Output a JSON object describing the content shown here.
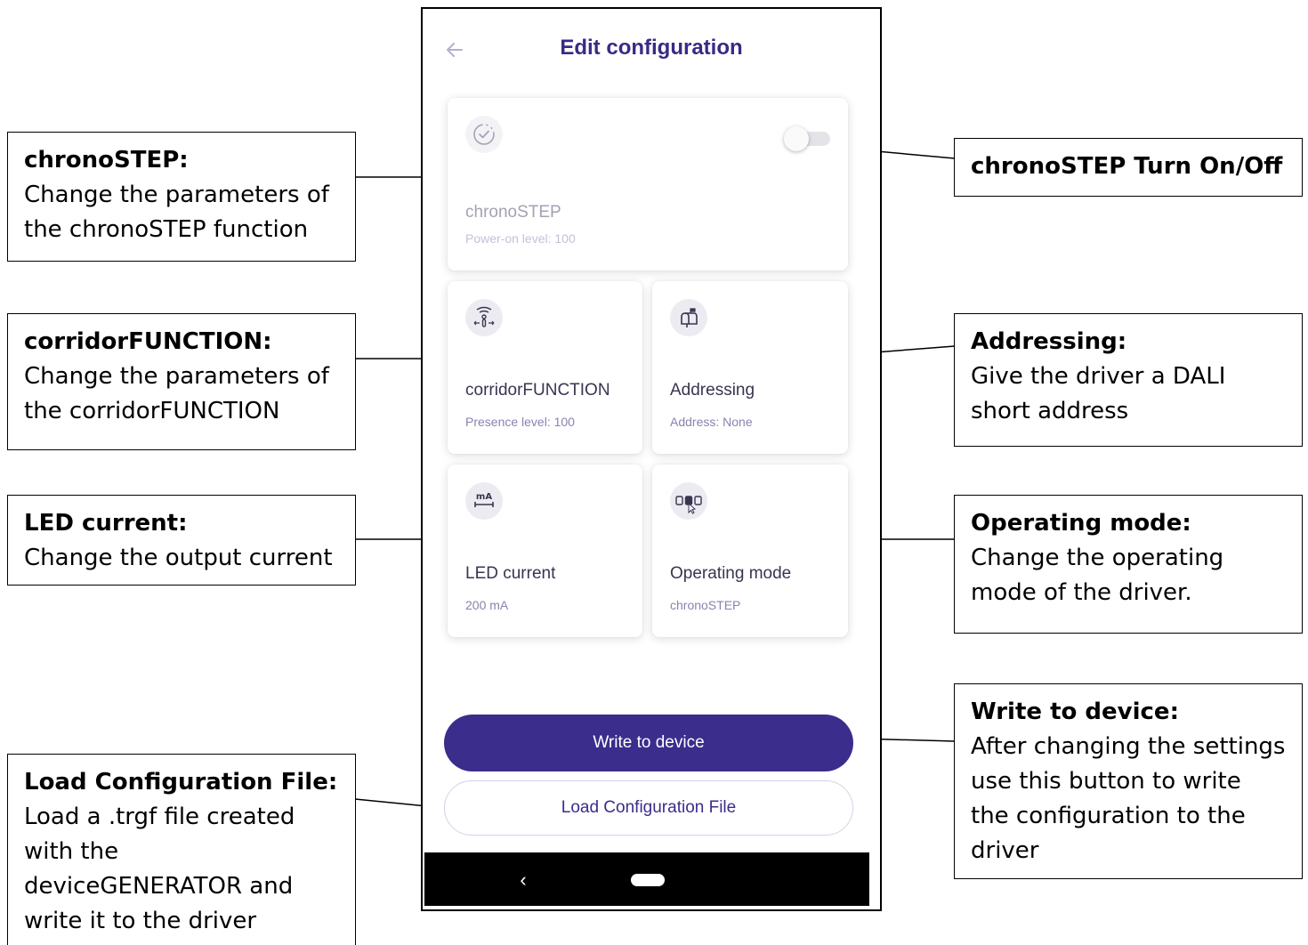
{
  "header": {
    "title": "Edit configuration",
    "back_icon": "arrow-left-icon"
  },
  "cards": {
    "chronostep": {
      "title": "chronoSTEP",
      "subtitle": "Power-on level: 100",
      "icon": "clock-icon",
      "toggle_on": false
    },
    "corridor": {
      "title": "corridorFUNCTION",
      "subtitle": "Presence level: 100",
      "icon": "presence-sensor-icon"
    },
    "addressing": {
      "title": "Addressing",
      "subtitle": "Address: None",
      "icon": "mailbox-icon"
    },
    "led_current": {
      "title": "LED current",
      "subtitle": "200 mA",
      "icon": "milliamp-icon",
      "icon_text": "mA"
    },
    "operating_mode": {
      "title": "Operating mode",
      "subtitle": "chronoSTEP",
      "icon": "mode-select-icon"
    }
  },
  "buttons": {
    "write": "Write to device",
    "load": "Load Configuration File"
  },
  "navbar": {
    "back_glyph": "‹"
  },
  "callouts": {
    "chronostep": {
      "title": "chronoSTEP:",
      "body": "Change the parameters of the chronoSTEP function"
    },
    "corridor": {
      "title": "corridorFUNCTION:",
      "body": "Change the parameters of the corridorFUNCTION"
    },
    "led": {
      "title": "LED current:",
      "body": "Change the output current"
    },
    "load": {
      "title": "Load Configuration File:",
      "body": "Load a .trgf file created with the deviceGENERATOR and write it to the driver"
    },
    "toggle": {
      "title": "chronoSTEP Turn On/Off"
    },
    "addressing": {
      "title": "Addressing:",
      "body": "Give the driver a DALI short address"
    },
    "operating": {
      "title": "Operating mode:",
      "body": "Change the operating mode of the driver."
    },
    "write": {
      "title": "Write to device:",
      "body": "After changing the settings use this button to write the configuration to the driver"
    }
  },
  "colors": {
    "accent": "#3a2d8c",
    "title": "#372b86",
    "subtitle": "#8a82b0"
  }
}
